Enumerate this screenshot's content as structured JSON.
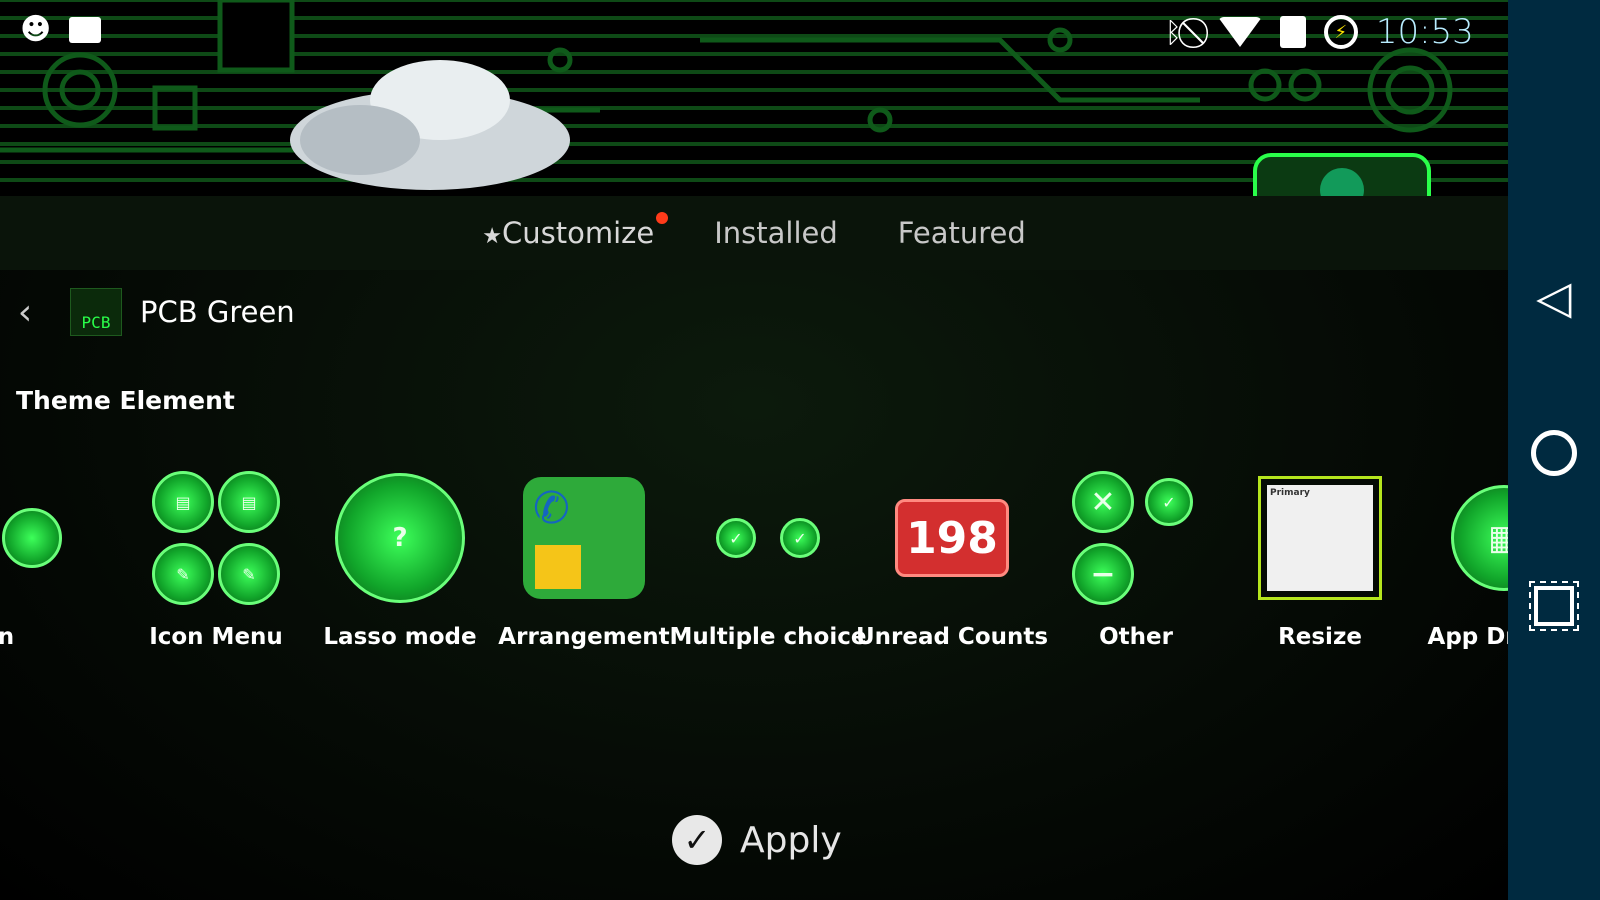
{
  "status_bar": {
    "time": "10:53",
    "left_icons": [
      "cyanogen-mascot-icon",
      "briefcase-icon"
    ],
    "right_icons": [
      "bluetooth-icon",
      "do-not-disturb-icon",
      "wifi-icon",
      "no-sim-icon",
      "battery-charging-icon"
    ]
  },
  "tabs": [
    {
      "label": "Customize",
      "icon": "star",
      "active": true,
      "notification": true
    },
    {
      "label": "Installed"
    },
    {
      "label": "Featured"
    }
  ],
  "theme": {
    "name": "PCB Green",
    "thumb_text": "PCB"
  },
  "section_title": "Theme Element",
  "elements": [
    {
      "label": "Icon"
    },
    {
      "label": "Icon Menu"
    },
    {
      "label": "Lasso mode"
    },
    {
      "label": "Arrangement"
    },
    {
      "label": "Multiple choice"
    },
    {
      "label": "Unread Counts",
      "badge": "198"
    },
    {
      "label": "Other"
    },
    {
      "label": "Resize",
      "preview_header": "Primary"
    },
    {
      "label": "App Drawer"
    }
  ],
  "apply_label": "Apply",
  "colors": {
    "accent": "#2aff4a",
    "navbar": "#002a40",
    "notification": "#ff3b1a",
    "clock": "#b8ecff"
  }
}
